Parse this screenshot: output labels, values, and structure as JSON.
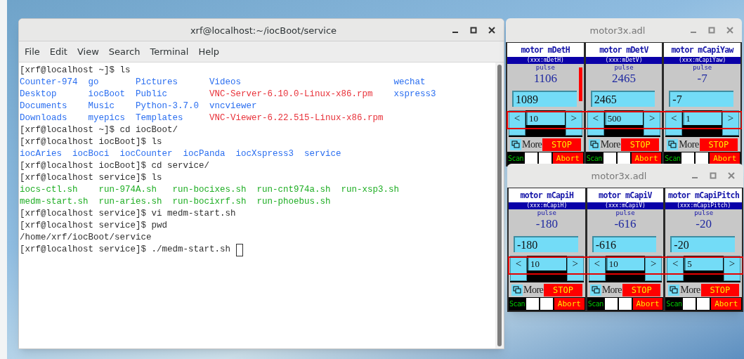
{
  "terminal": {
    "title": "xrf@localhost:~/iocBoot/service",
    "menu": [
      "File",
      "Edit",
      "View",
      "Search",
      "Terminal",
      "Help"
    ],
    "output": [
      {
        "kind": "command",
        "prompt": "[xrf@localhost ~]$",
        "command": "ls",
        "cursor": false
      },
      {
        "kind": "listing",
        "rows": [
          [
            {
              "text": "Counter-974",
              "kind": "dir"
            },
            {
              "text": "go",
              "kind": "dir"
            },
            {
              "text": "Pictures",
              "kind": "dir"
            },
            {
              "text": "Videos",
              "kind": "dir"
            },
            {
              "text": "wechat",
              "kind": "dir"
            }
          ],
          [
            {
              "text": "Desktop",
              "kind": "dir"
            },
            {
              "text": "iocBoot",
              "kind": "dir"
            },
            {
              "text": "Public",
              "kind": "dir"
            },
            {
              "text": "VNC-Server-6.10.0-Linux-x86.rpm",
              "kind": "archive"
            },
            {
              "text": "xspress3",
              "kind": "dir"
            }
          ],
          [
            {
              "text": "Documents",
              "kind": "dir"
            },
            {
              "text": "Music",
              "kind": "dir"
            },
            {
              "text": "Python-3.7.0",
              "kind": "dir"
            },
            {
              "text": "vncviewer",
              "kind": "dir"
            }
          ],
          [
            {
              "text": "Downloads",
              "kind": "dir"
            },
            {
              "text": "myepics",
              "kind": "dir"
            },
            {
              "text": "Templates",
              "kind": "dir"
            },
            {
              "text": "VNC-Viewer-6.22.515-Linux-x86.rpm",
              "kind": "archive"
            }
          ]
        ]
      },
      {
        "kind": "command",
        "prompt": "[xrf@localhost ~]$",
        "command": "cd iocBoot/",
        "cursor": false
      },
      {
        "kind": "command",
        "prompt": "[xrf@localhost iocBoot]$",
        "command": "ls",
        "cursor": false
      },
      {
        "kind": "listing",
        "rows": [
          [
            {
              "text": "iocAries",
              "kind": "dir"
            },
            {
              "text": "iocBoci",
              "kind": "dir"
            },
            {
              "text": "iocCounter",
              "kind": "dir"
            },
            {
              "text": "iocPanda",
              "kind": "dir"
            },
            {
              "text": "iocXspress3",
              "kind": "dir"
            },
            {
              "text": "service",
              "kind": "dir"
            }
          ]
        ]
      },
      {
        "kind": "command",
        "prompt": "[xrf@localhost iocBoot]$",
        "command": "cd service/",
        "cursor": false
      },
      {
        "kind": "command",
        "prompt": "[xrf@localhost service]$",
        "command": "ls",
        "cursor": false
      },
      {
        "kind": "listing",
        "rows": [
          [
            {
              "text": "iocs-ctl.sh",
              "kind": "exec"
            },
            {
              "text": "run-974A.sh",
              "kind": "exec"
            },
            {
              "text": "run-bocixes.sh",
              "kind": "exec"
            },
            {
              "text": "run-cnt974a.sh",
              "kind": "exec"
            },
            {
              "text": "run-xsp3.sh",
              "kind": "exec"
            }
          ],
          [
            {
              "text": "medm-start.sh",
              "kind": "exec"
            },
            {
              "text": "run-aries.sh",
              "kind": "exec"
            },
            {
              "text": "run-bocixrf.sh",
              "kind": "exec"
            },
            {
              "text": "run-phoebus.sh",
              "kind": "exec"
            }
          ]
        ]
      },
      {
        "kind": "command",
        "prompt": "[xrf@localhost service]$",
        "command": "vi medm-start.sh",
        "cursor": false
      },
      {
        "kind": "command",
        "prompt": "[xrf@localhost service]$",
        "command": "pwd",
        "cursor": false
      },
      {
        "kind": "text",
        "text": "/home/xrf/iocBoot/service"
      },
      {
        "kind": "command",
        "prompt": "[xrf@localhost service]$",
        "command": "./medm-start.sh",
        "cursor": true
      }
    ]
  },
  "motor_windows": [
    {
      "title": "motor3x.adl",
      "highlight": true,
      "panels": [
        {
          "title": "motor mDetH",
          "pv": "(xxx:mDetH)",
          "unit": "pulse",
          "readback": "1106",
          "drive": "1089",
          "tweak_left": "<",
          "tweak": "10",
          "tweak_right": ">",
          "moving": true,
          "more": "More",
          "stop": "STOP",
          "scan": "Scan",
          "abort": "Abort"
        },
        {
          "title": "motor mDetV",
          "pv": "(xxx:mDetV)",
          "unit": "pulse",
          "readback": "2465",
          "drive": "2465",
          "tweak_left": "<",
          "tweak": "500",
          "tweak_right": ">",
          "moving": false,
          "more": "More",
          "stop": "STOP",
          "scan": "Scan",
          "abort": "Abort"
        },
        {
          "title": "motor mCapiYaw",
          "pv": "(xxx:mCapiYaw)",
          "unit": "pulse",
          "readback": "-7",
          "drive": "-7",
          "tweak_left": "<",
          "tweak": "1",
          "tweak_right": ">",
          "moving": false,
          "more": "More",
          "stop": "STOP",
          "scan": "Scan",
          "abort": "Abort"
        }
      ]
    },
    {
      "title": "motor3x.adl",
      "highlight": true,
      "panels": [
        {
          "title": "motor mCapiH",
          "pv": "(xxx:mCapiH)",
          "unit": "pulse",
          "readback": "-180",
          "drive": "-180",
          "tweak_left": "<",
          "tweak": "10",
          "tweak_right": ">",
          "moving": false,
          "more": "More",
          "stop": "STOP",
          "scan": "Scan",
          "abort": "Abort"
        },
        {
          "title": "motor mCapiV",
          "pv": "(xxx:mCapiV)",
          "unit": "pulse",
          "readback": "-616",
          "drive": "-616",
          "tweak_left": "<",
          "tweak": "10",
          "tweak_right": ">",
          "moving": false,
          "more": "More",
          "stop": "STOP",
          "scan": "Scan",
          "abort": "Abort"
        },
        {
          "title": "motor mCapiPitch",
          "pv": "(xxx:mCapiPitch)",
          "unit": "pulse",
          "readback": "-20",
          "drive": "-20",
          "tweak_left": "<",
          "tweak": "5",
          "tweak_right": ">",
          "moving": false,
          "more": "More",
          "stop": "STOP",
          "scan": "Scan",
          "abort": "Abort"
        }
      ]
    }
  ]
}
